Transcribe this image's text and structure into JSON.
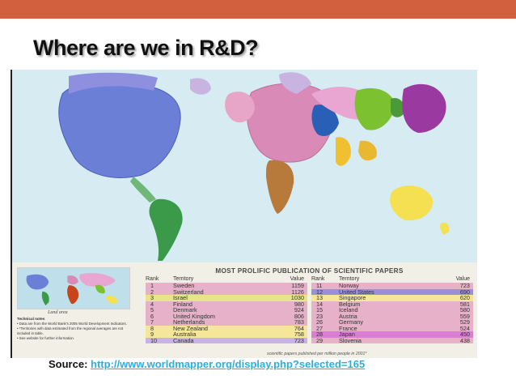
{
  "slide": {
    "title": "Where are we in R&D?",
    "accent_color": "#d2603f"
  },
  "source": {
    "label": "Source:",
    "url": "http://www.worldmapper.org/display.php?selected=165"
  },
  "figure": {
    "table_title": "MOST PROLIFIC PUBLICATION OF SCIENTIFIC PAPERS",
    "columns": [
      "Rank",
      "Territory",
      "Value"
    ],
    "left_rows": [
      {
        "rank": "1",
        "territory": "Sweden",
        "value": "1159",
        "color": "#e7b2c9"
      },
      {
        "rank": "2",
        "territory": "Switzerland",
        "value": "1126",
        "color": "#e7b2c9"
      },
      {
        "rank": "3",
        "territory": "Israel",
        "value": "1030",
        "color": "#e6e58a"
      },
      {
        "rank": "4",
        "territory": "Finland",
        "value": "980",
        "color": "#e7b2c9"
      },
      {
        "rank": "5",
        "territory": "Denmark",
        "value": "924",
        "color": "#e7b2c9"
      },
      {
        "rank": "6",
        "territory": "United Kingdom",
        "value": "806",
        "color": "#e7b2c9"
      },
      {
        "rank": "7",
        "territory": "Netherlands",
        "value": "783",
        "color": "#e7b2c9"
      },
      {
        "rank": "8",
        "territory": "New Zealand",
        "value": "764",
        "color": "#f4e79a"
      },
      {
        "rank": "9",
        "territory": "Australia",
        "value": "758",
        "color": "#f4e79a"
      },
      {
        "rank": "10",
        "territory": "Canada",
        "value": "723",
        "color": "#c9b3e0"
      }
    ],
    "right_rows": [
      {
        "rank": "11",
        "territory": "Norway",
        "value": "723",
        "color": "#e7b2c9"
      },
      {
        "rank": "12",
        "territory": "United States",
        "value": "690",
        "color": "#9b8fd6"
      },
      {
        "rank": "13",
        "territory": "Singapore",
        "value": "620",
        "color": "#f4e79a"
      },
      {
        "rank": "14",
        "territory": "Belgium",
        "value": "581",
        "color": "#e7b2c9"
      },
      {
        "rank": "15",
        "territory": "Iceland",
        "value": "580",
        "color": "#e7b2c9"
      },
      {
        "rank": "23",
        "territory": "Austria",
        "value": "559",
        "color": "#e7b2c9"
      },
      {
        "rank": "26",
        "territory": "Germany",
        "value": "529",
        "color": "#e7b2c9"
      },
      {
        "rank": "27",
        "territory": "France",
        "value": "524",
        "color": "#e7b2c9"
      },
      {
        "rank": "28",
        "territory": "Japan",
        "value": "450",
        "color": "#d97ed2"
      },
      {
        "rank": "29",
        "territory": "Slovenia",
        "value": "438",
        "color": "#e7b2c9"
      }
    ],
    "footnote": "scientific papers published per million people in 2001*",
    "inset_caption": "Land area",
    "technical_notes_title": "Technical notes",
    "technical_notes": [
      "• Data are from the World Bank's 2005 World Development Indicators.",
      "• *Territories with data estimated from the regional averages are not included in table.",
      "• See website for further information."
    ]
  }
}
